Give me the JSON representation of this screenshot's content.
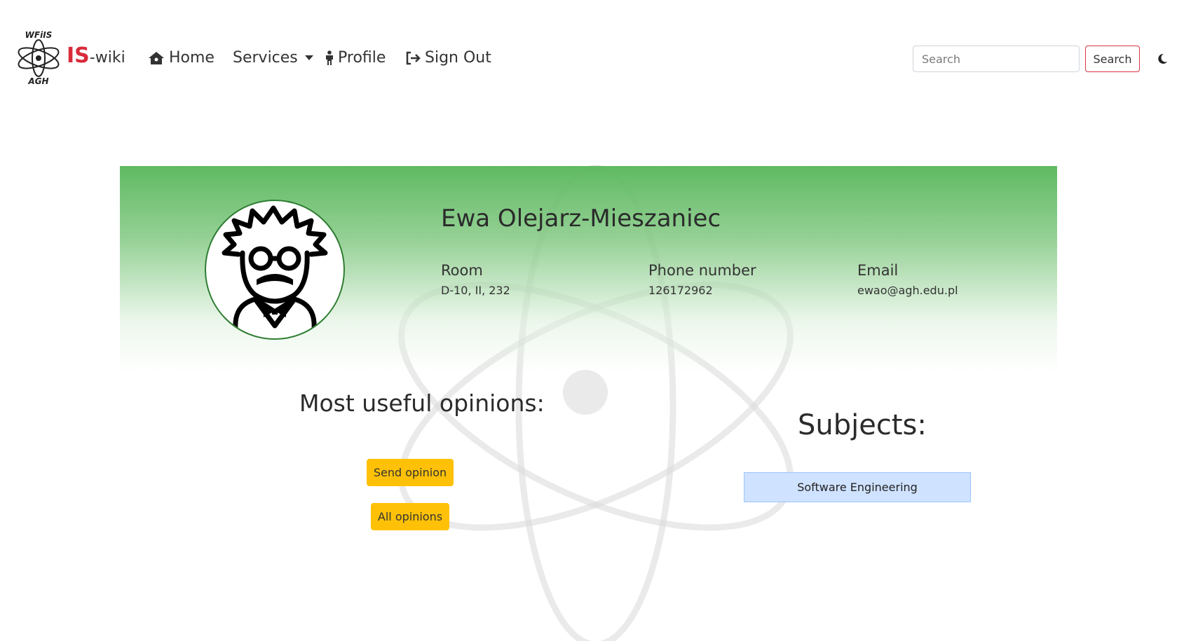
{
  "nav": {
    "logo_top_text": "WFiIS",
    "logo_bottom_text": "AGH",
    "brand_prefix": "IS",
    "brand_suffix": "-wiki",
    "items": [
      {
        "label": "Home",
        "icon": "home-icon"
      },
      {
        "label": "Services",
        "icon": null,
        "dropdown": true
      },
      {
        "label": "Profile",
        "icon": "person-icon"
      },
      {
        "label": "Sign Out",
        "icon": "sign-out-icon"
      }
    ],
    "search_placeholder": "Search",
    "search_button_label": "Search",
    "theme_icon": "moon-icon"
  },
  "profile": {
    "name": "Ewa Olejarz-Mieszaniec",
    "avatar_icon": "scientist-avatar-icon",
    "fields": [
      {
        "label": "Room",
        "value": "D-10, II, 232"
      },
      {
        "label": "Phone number",
        "value": "126172962"
      },
      {
        "label": "Email",
        "value": "ewao@agh.edu.pl"
      }
    ]
  },
  "opinions": {
    "title": "Most useful opinions:",
    "send_button": "Send opinion",
    "all_button": "All opinions"
  },
  "subjects": {
    "title": "Subjects:",
    "items": [
      "Software Engineering"
    ]
  },
  "colors": {
    "brand_red": "#d92b3a",
    "header_green": "#5cb95f",
    "warning": "#ffc107",
    "subject_bg": "#cfe2ff"
  }
}
